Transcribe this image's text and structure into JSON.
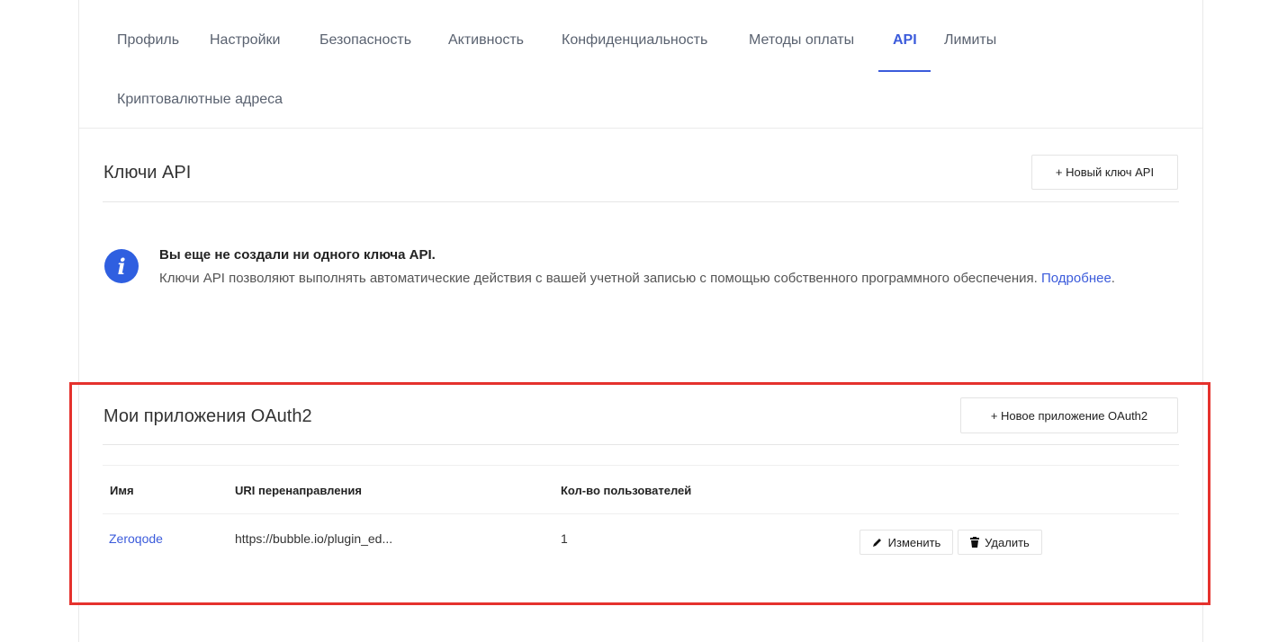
{
  "tabs": {
    "row1": [
      "Профиль",
      "Настройки",
      "Безопасность",
      "Активность",
      "Конфиденциальность",
      "Методы оплаты",
      "API",
      "Лимиты"
    ],
    "row2": [
      "Криптовалютные адреса"
    ],
    "active": "API"
  },
  "api_keys": {
    "title": "Ключи API",
    "new_button": "+ Новый ключ API",
    "info_icon": "info-icon",
    "notice_title": "Вы еще не создали ни одного ключа API.",
    "notice_text": "Ключи API позволяют выполнять автоматические действия с вашей учетной записью с помощью собственного программного обеспечения. ",
    "notice_link": "Подробнее",
    "notice_end": "."
  },
  "oauth": {
    "title": "Мои приложения OAuth2",
    "new_button": "+ Новое приложение OAuth2",
    "columns": [
      "Имя",
      "URI перенаправления",
      "Кол-во пользователей"
    ],
    "rows": [
      {
        "name": "Zeroqode",
        "uri": "https://bubble.io/plugin_ed...",
        "users": "1",
        "edit": "Изменить",
        "delete": "Удалить"
      }
    ]
  },
  "colors": {
    "accent": "#3b5bdb",
    "highlight": "#e5322d"
  }
}
